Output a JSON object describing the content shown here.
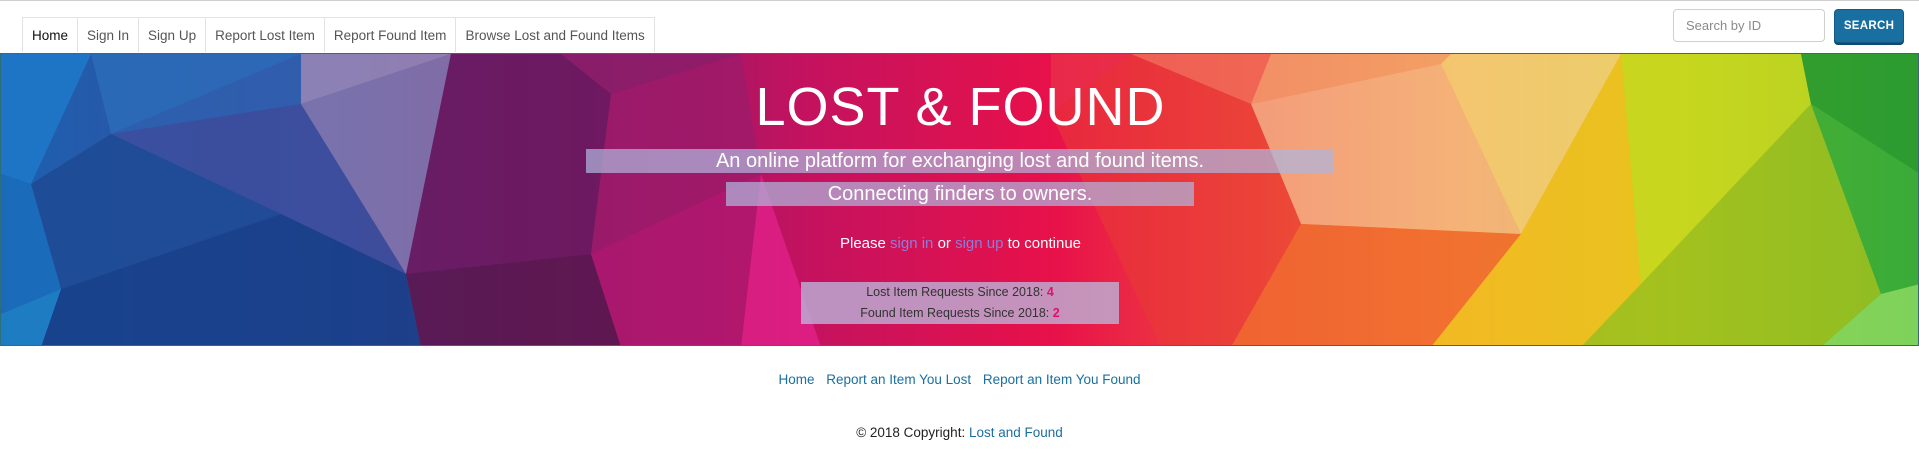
{
  "nav": {
    "tabs": [
      {
        "label": "Home",
        "active": true
      },
      {
        "label": "Sign In"
      },
      {
        "label": "Sign Up"
      },
      {
        "label": "Report Lost Item"
      },
      {
        "label": "Report Found Item"
      },
      {
        "label": "Browse Lost and Found Items"
      }
    ]
  },
  "search": {
    "placeholder": "Search by ID",
    "button_label": "SEARCH"
  },
  "hero": {
    "title": "LOST & FOUND",
    "tagline1": "An online platform for exchanging lost and found items.",
    "tagline2": "Connecting finders to owners.",
    "prompt_prefix": "Please",
    "sign_in_link": "sign in",
    "or_text": "or",
    "sign_up_link": "sign up",
    "prompt_suffix": "to continue",
    "lost_label": "Lost Item Requests Since 2018:",
    "lost_count": "4",
    "found_label": "Found Item Requests Since 2018:",
    "found_count": "2"
  },
  "footer": {
    "links": [
      "Home",
      "Report an Item You Lost",
      "Report an Item You Found"
    ],
    "copyright_text": "© 2018 Copyright:",
    "copyright_link": "Lost and Found"
  },
  "colors": {
    "accent": "#1a6fa1",
    "count": "#e0116d"
  }
}
